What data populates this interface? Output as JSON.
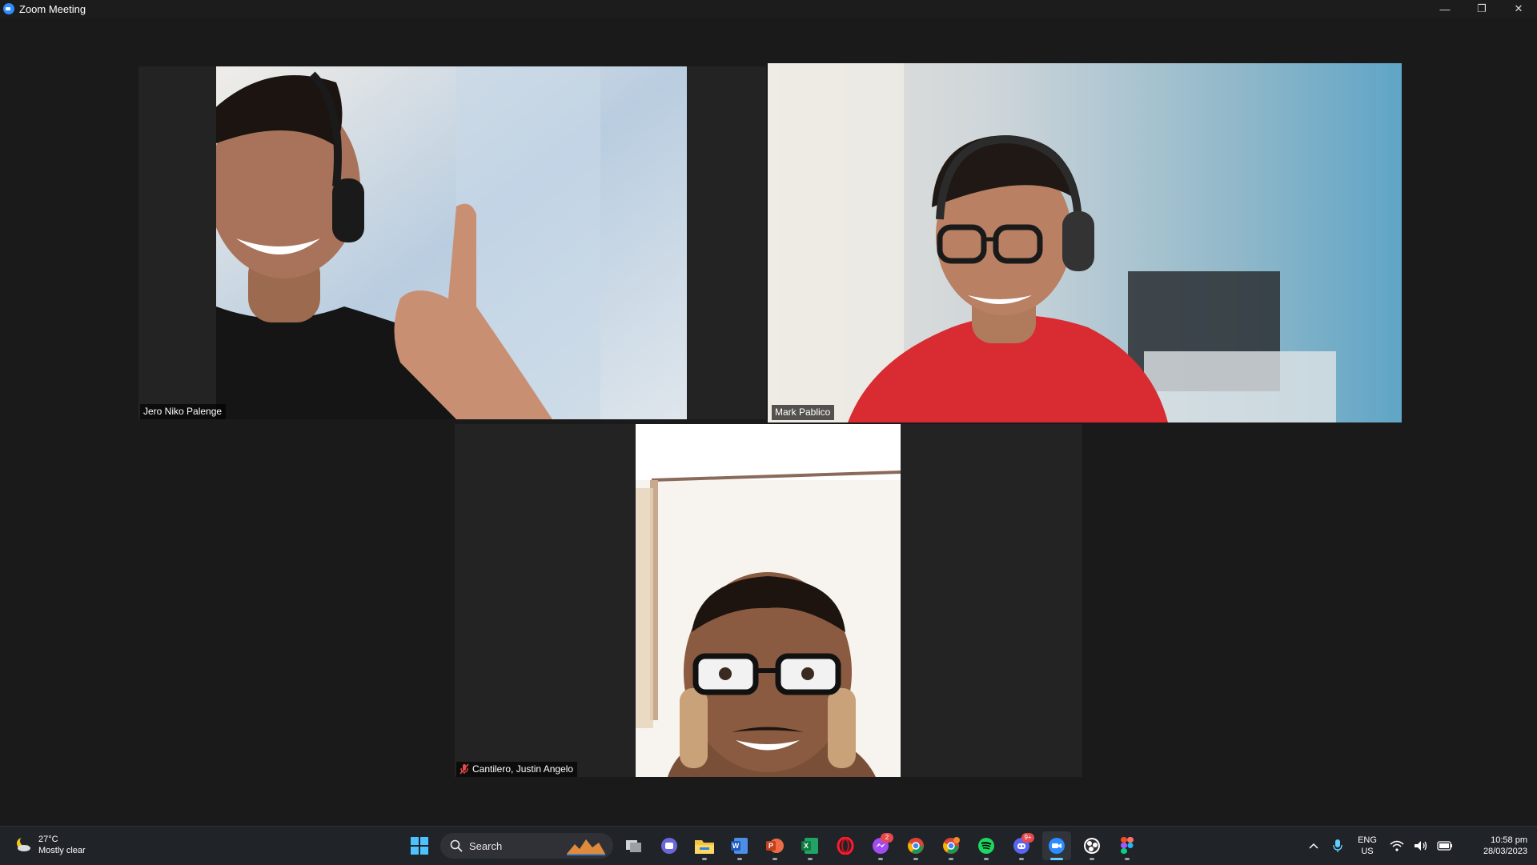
{
  "window": {
    "title": "Zoom Meeting",
    "controls": [
      "—",
      "❐",
      "✕"
    ]
  },
  "participants": [
    {
      "name": "Jero Niko Palenge",
      "muted": false,
      "active_speaker": false
    },
    {
      "name": "Mark Pablico",
      "muted": false,
      "active_speaker": true
    },
    {
      "name": "Cantilero, Justin Angelo",
      "muted": true,
      "active_speaker": false
    }
  ],
  "colors": {
    "active_speaker_border": "#e4eb8a",
    "muted_icon": "#e5484d",
    "taskbar_accent": "#60cdff"
  },
  "taskbar": {
    "weather": {
      "temperature": "27°C",
      "condition": "Mostly clear"
    },
    "search_label": "Search",
    "apps": [
      {
        "name": "start-menu-icon"
      },
      {
        "name": "task-view-icon"
      },
      {
        "name": "teams-chat-icon"
      },
      {
        "name": "file-explorer-icon",
        "running": true
      },
      {
        "name": "word-icon",
        "running": true
      },
      {
        "name": "powerpoint-icon",
        "running": true
      },
      {
        "name": "excel-icon",
        "running": true
      },
      {
        "name": "opera-icon"
      },
      {
        "name": "messenger-icon",
        "badge": "2",
        "running": true
      },
      {
        "name": "chrome-icon",
        "running": true
      },
      {
        "name": "chrome-profile-icon",
        "running": true
      },
      {
        "name": "spotify-icon",
        "running": true
      },
      {
        "name": "discord-icon",
        "badge": "9+",
        "running": true
      },
      {
        "name": "zoom-icon",
        "running": true,
        "active": true
      },
      {
        "name": "obs-icon",
        "running": true
      },
      {
        "name": "figma-icon",
        "running": true
      }
    ],
    "tray": {
      "language": "ENG",
      "region": "US",
      "time": "10:58 pm",
      "date": "28/03/2023"
    }
  }
}
